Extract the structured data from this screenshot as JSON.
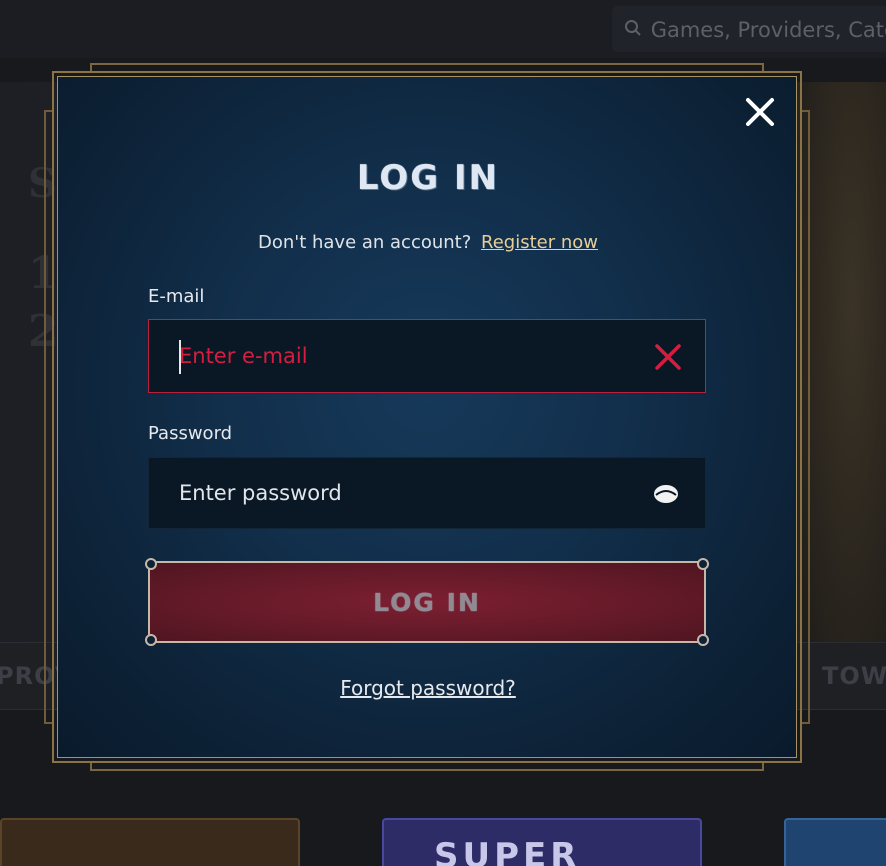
{
  "background": {
    "search_placeholder": "Games, Providers, Cate",
    "banner_glyphs": [
      "S",
      "1",
      "2"
    ],
    "category_left": "PROV",
    "category_right": "TOW",
    "tile_text": "SUPER"
  },
  "modal": {
    "title": "LOG IN",
    "register_prompt": "Don't have an account?",
    "register_link": "Register now",
    "email": {
      "label": "E-mail",
      "placeholder": "Enter e-mail",
      "value": ""
    },
    "password": {
      "label": "Password",
      "placeholder": "Enter password",
      "value": ""
    },
    "submit_label": "LOG IN",
    "forgot_link": "Forgot password?"
  },
  "colors": {
    "error_red": "#d51e3f",
    "gold_border": "#8a7446",
    "link_gold": "#e7cf97",
    "modal_bg": "#12304d",
    "button_red": "#7c1f31"
  },
  "icons": {
    "close": "close-icon",
    "clear": "clear-icon",
    "eye": "eye-icon",
    "search": "search-icon"
  }
}
